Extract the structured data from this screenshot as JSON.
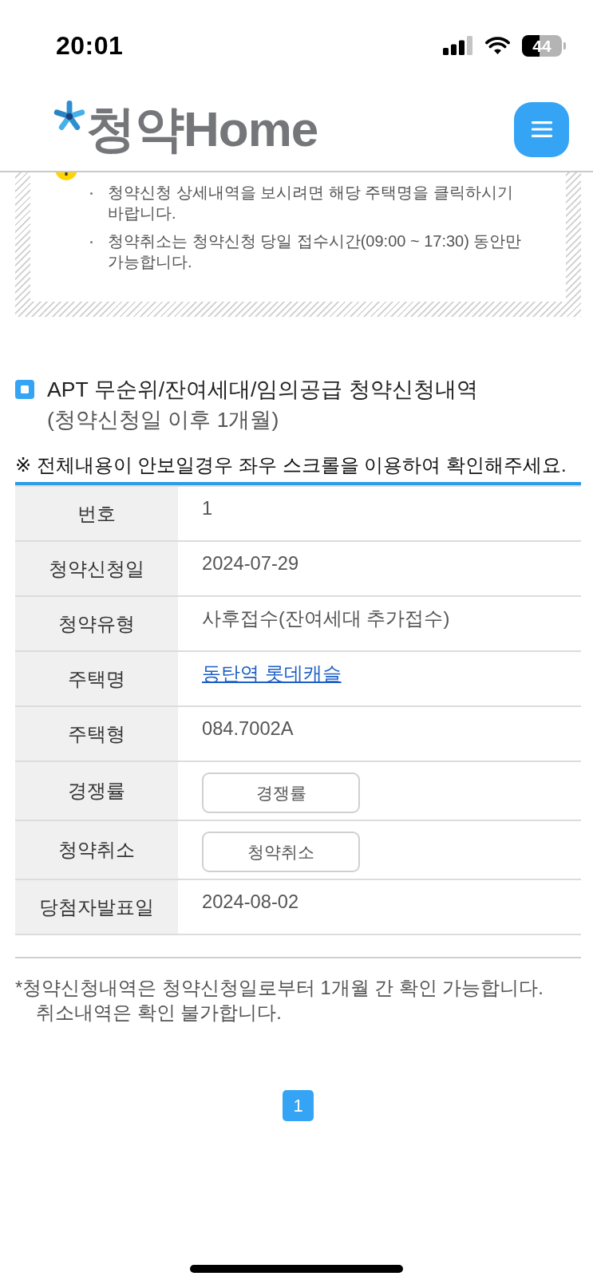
{
  "status_bar": {
    "time": "20:01",
    "battery": "44"
  },
  "header": {
    "logo": "청약Home"
  },
  "notice": {
    "items": [
      "청약신청 상세내역을 보시려면 해당 주택명을 클릭하시기 바랍니다.",
      "청약취소는 청약신청 당일 접수시간(09:00 ~ 17:30) 동안만 가능합니다."
    ]
  },
  "section": {
    "title": "APT 무순위/잔여세대/임의공급 청약신청내역",
    "subtitle": "(청약신청일 이후 1개월)",
    "scroll_hint": "※ 전체내용이 안보일경우 좌우 스크롤을 이용하여 확인해주세요."
  },
  "table": {
    "rows": [
      {
        "label": "번호",
        "kind": "text",
        "value": "1"
      },
      {
        "label": "청약신청일",
        "kind": "text",
        "value": "2024-07-29"
      },
      {
        "label": "청약유형",
        "kind": "text",
        "value": "사후접수(잔여세대 추가접수)"
      },
      {
        "label": "주택명",
        "kind": "link",
        "value": "동탄역 롯데캐슬"
      },
      {
        "label": "주택형",
        "kind": "text",
        "value": "084.7002A"
      },
      {
        "label": "경쟁률",
        "kind": "button",
        "value": "경쟁률"
      },
      {
        "label": "청약취소",
        "kind": "button",
        "value": "청약취소"
      },
      {
        "label": "당첨자발표일",
        "kind": "text",
        "value": "2024-08-02"
      }
    ]
  },
  "footnote": "*청약신청내역은 청약신청일로부터 1개월 간 확인 가능합니다. 취소내역은 확인 불가합니다.",
  "pagination": {
    "pages": [
      {
        "label": "1",
        "selected": true
      }
    ]
  }
}
